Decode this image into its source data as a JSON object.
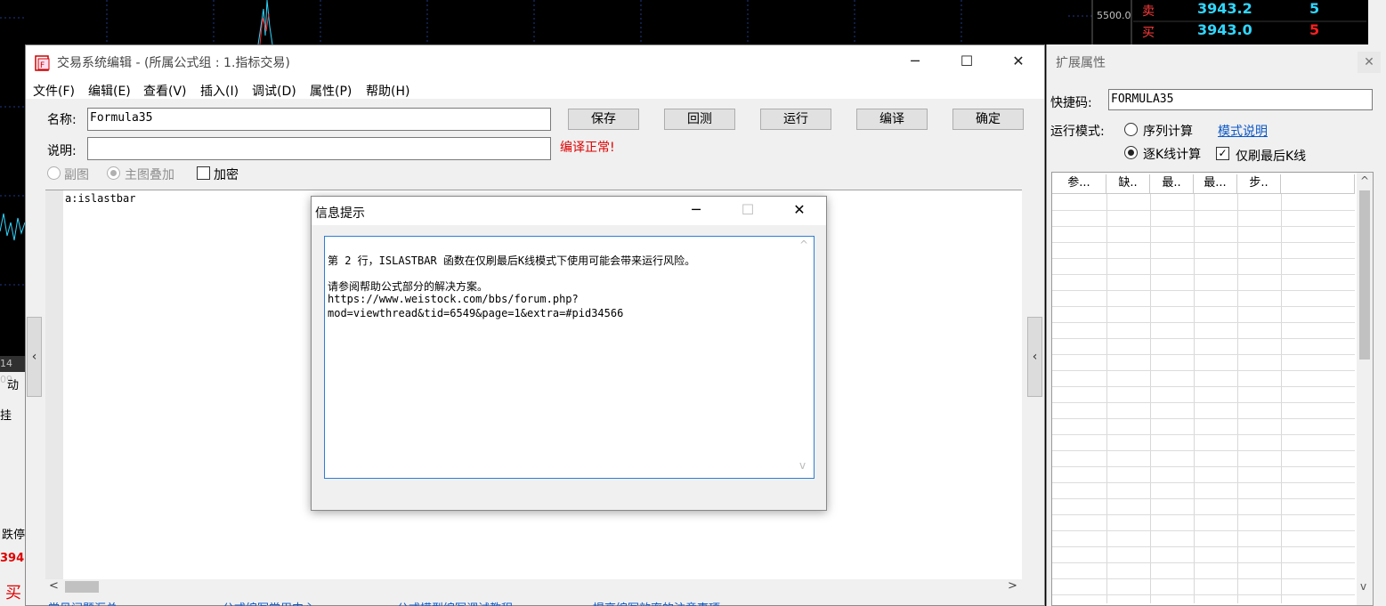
{
  "background": {
    "price_level": "5500.0",
    "quotes": [
      {
        "label": "卖",
        "price": "3943.2",
        "volume": "5",
        "volume_color": "#2fd7ff"
      },
      {
        "label": "买",
        "price": "3943.0",
        "volume": "5",
        "volume_color": "#ff2020"
      }
    ],
    "left_fragments": [
      "14",
      "09",
      "动",
      "挂",
      "跌停",
      "394",
      "买"
    ]
  },
  "editor_window": {
    "title": "交易系统编辑 - (所属公式组 : 1.指标交易)",
    "controls": {
      "minimize": "─",
      "maximize": "☐",
      "close": "✕"
    },
    "menu": [
      "文件(F)",
      "编辑(E)",
      "查看(V)",
      "插入(I)",
      "调试(D)",
      "属性(P)",
      "帮助(H)"
    ],
    "name_label": "名称:",
    "name_value": "Formula35",
    "desc_label": "说明:",
    "desc_value": "",
    "compile_status": "编译正常!",
    "compile_status_color": "#e00000",
    "buttons": [
      "保存",
      "回测",
      "运行",
      "编译",
      "确定"
    ],
    "options": {
      "sub_chart": "副图",
      "main_overlay": "主图叠加",
      "encrypt": "加密"
    },
    "code": "a:islastbar",
    "bottom_links": [
      "常见问题汇总",
      "公式编写常用中心",
      "公式模型编写调试教程",
      "提高编写效率的注意事项"
    ]
  },
  "property_panel": {
    "title": "扩展属性",
    "close": "✕",
    "shortcut_label": "快捷码:",
    "shortcut_value": "FORMULA35",
    "run_mode_label": "运行模式:",
    "mode_series": "序列计算",
    "mode_explain": "模式说明",
    "mode_bar": "逐K线计算",
    "refresh_last": "仅刷最后K线",
    "columns": [
      "参...",
      "缺..",
      "最..",
      "最...",
      "步.."
    ]
  },
  "dialog": {
    "title": "信息提示",
    "controls": {
      "minimize": "─",
      "maximize": "☐",
      "close": "✕"
    },
    "lines": [
      "第 2 行，ISLASTBAR 函数在仅刷最后K线模式下使用可能会带来运行风险。",
      "请参阅帮助公式部分的解决方案。",
      "https://www.weistock.com/bbs/forum.php?",
      "mod=viewthread&tid=6549&page=1&extra=#pid34566"
    ]
  }
}
